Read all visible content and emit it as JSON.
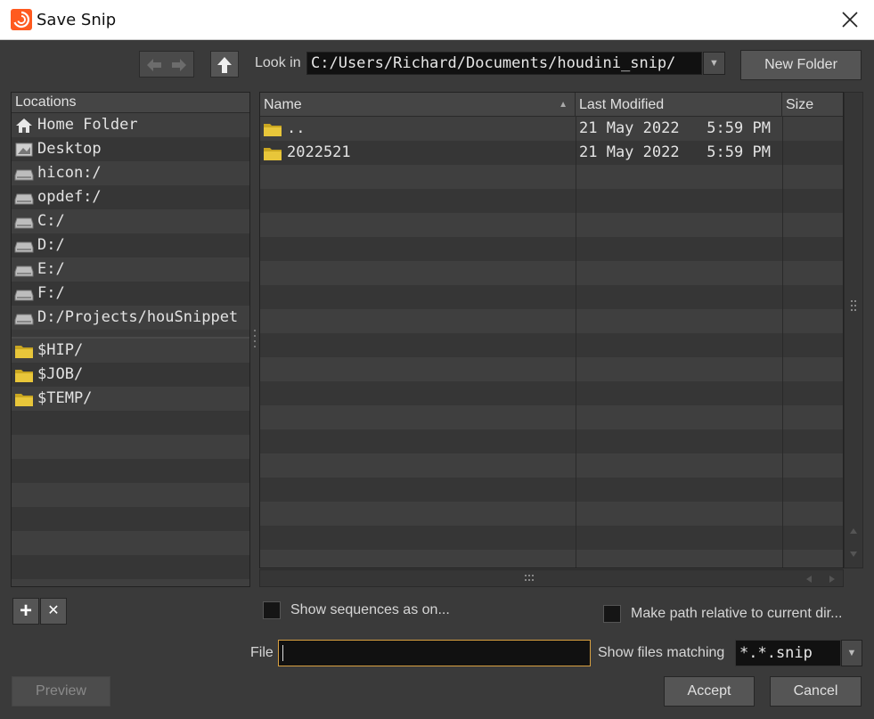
{
  "window": {
    "title": "Save Snip",
    "close_glyph": "✕"
  },
  "toolbar": {
    "back_icon": "left-arrow-icon",
    "forward_icon": "right-arrow-icon",
    "up_icon": "up-arrow-icon",
    "look_in_label": "Look in",
    "look_in_value": "C:/Users/Richard/Documents/houdini_snip/",
    "dropdown_glyph": "▼",
    "new_folder_label": "New Folder"
  },
  "locations": {
    "header": "Locations",
    "items": [
      {
        "label": "Home Folder",
        "icon": "home-icon"
      },
      {
        "label": "Desktop",
        "icon": "desktop-icon"
      },
      {
        "label": "hicon:/",
        "icon": "drive-icon"
      },
      {
        "label": "opdef:/",
        "icon": "drive-icon"
      },
      {
        "label": "C:/",
        "icon": "drive-icon"
      },
      {
        "label": "D:/",
        "icon": "drive-icon"
      },
      {
        "label": "E:/",
        "icon": "drive-icon"
      },
      {
        "label": "F:/",
        "icon": "drive-icon"
      },
      {
        "label": "D:/Projects/houSnippet",
        "icon": "drive-icon"
      }
    ],
    "bookmarks": [
      {
        "label": "$HIP/",
        "icon": "folder-icon"
      },
      {
        "label": "$JOB/",
        "icon": "folder-icon"
      },
      {
        "label": "$TEMP/",
        "icon": "folder-icon"
      }
    ]
  },
  "files": {
    "columns": {
      "name": "Name",
      "modified": "Last Modified",
      "size": "Size",
      "sort_glyph": "▲"
    },
    "rows": [
      {
        "name": "..",
        "modified": "21 May 2022   5:59 PM",
        "size": ""
      },
      {
        "name": "2022521",
        "modified": "21 May 2022   5:59 PM",
        "size": ""
      }
    ]
  },
  "actions": {
    "add_glyph": "+",
    "remove_glyph": "✕",
    "show_sequences_label": "Show sequences as on...",
    "make_relative_label": "Make path relative to current dir...",
    "file_label": "File",
    "file_value": "",
    "show_files_matching_label": "Show files matching",
    "filter_value": "*.*.snip",
    "preview_label": "Preview",
    "accept_label": "Accept",
    "cancel_label": "Cancel"
  },
  "colors": {
    "accent_border": "#d8a040",
    "folder_yellow": "#e8c63a"
  }
}
